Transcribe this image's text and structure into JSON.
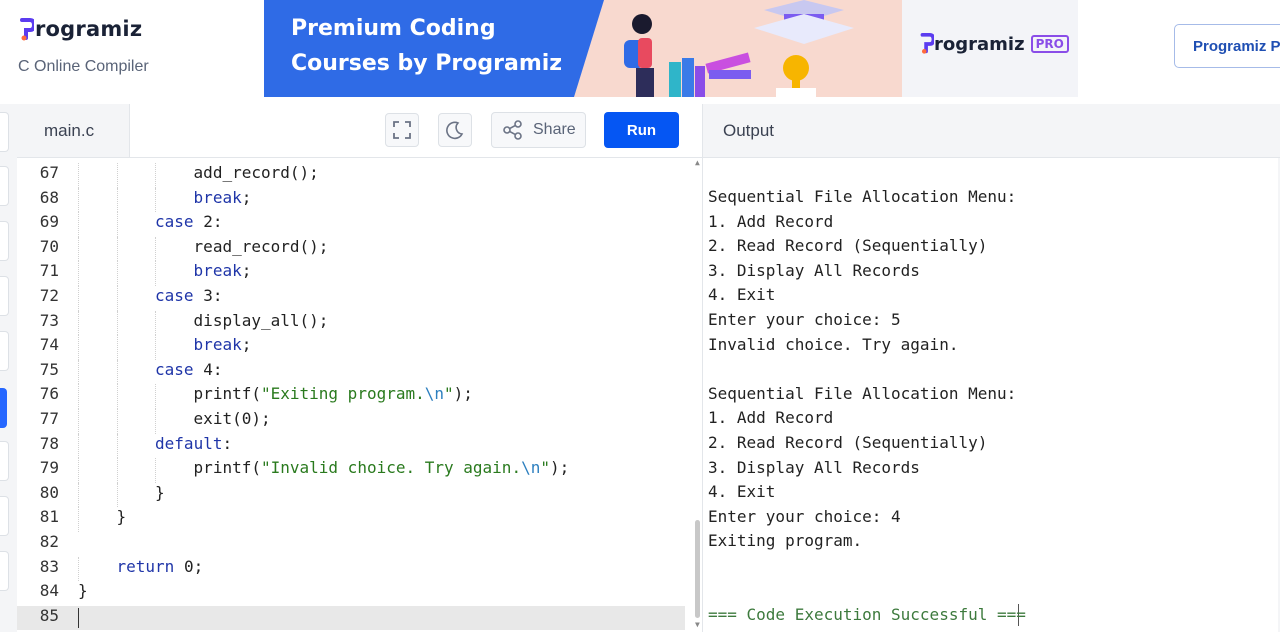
{
  "header": {
    "brand": "rogramiz",
    "subtitle": "C Online Compiler",
    "banner_line1": "Premium Coding",
    "banner_line2": "Courses by Programiz",
    "banner_brand": "rogramiz",
    "banner_badge": "PRO",
    "pro_button": "Programiz P"
  },
  "editor": {
    "file_tab": "main.c",
    "share_label": "Share",
    "run_label": "Run"
  },
  "output": {
    "title": "Output",
    "lines": [
      "",
      "Sequential File Allocation Menu:",
      "1. Add Record",
      "2. Read Record (Sequentially)",
      "3. Display All Records",
      "4. Exit",
      "Enter your choice: 5",
      "Invalid choice. Try again.",
      "",
      "Sequential File Allocation Menu:",
      "1. Add Record",
      "2. Read Record (Sequentially)",
      "3. Display All Records",
      "4. Exit",
      "Enter your choice: 4",
      "Exiting program.",
      "",
      "",
      "=== Code Execution Successful ==="
    ]
  },
  "code": [
    {
      "n": "67",
      "parts": [
        [
          "fn",
          "add_record();"
        ]
      ],
      "indent": 3
    },
    {
      "n": "68",
      "parts": [
        [
          "kw",
          "break"
        ],
        [
          "fn",
          ";"
        ]
      ],
      "indent": 3
    },
    {
      "n": "69",
      "parts": [
        [
          "kw",
          "case "
        ],
        [
          "num",
          "2"
        ],
        [
          "fn",
          ":"
        ]
      ],
      "indent": 2
    },
    {
      "n": "70",
      "parts": [
        [
          "fn",
          "read_record();"
        ]
      ],
      "indent": 3
    },
    {
      "n": "71",
      "parts": [
        [
          "kw",
          "break"
        ],
        [
          "fn",
          ";"
        ]
      ],
      "indent": 3
    },
    {
      "n": "72",
      "parts": [
        [
          "kw",
          "case "
        ],
        [
          "num",
          "3"
        ],
        [
          "fn",
          ":"
        ]
      ],
      "indent": 2
    },
    {
      "n": "73",
      "parts": [
        [
          "fn",
          "display_all();"
        ]
      ],
      "indent": 3
    },
    {
      "n": "74",
      "parts": [
        [
          "kw",
          "break"
        ],
        [
          "fn",
          ";"
        ]
      ],
      "indent": 3
    },
    {
      "n": "75",
      "parts": [
        [
          "kw",
          "case "
        ],
        [
          "num",
          "4"
        ],
        [
          "fn",
          ":"
        ]
      ],
      "indent": 2
    },
    {
      "n": "76",
      "parts": [
        [
          "fn",
          "printf("
        ],
        [
          "str",
          "\"Exiting program."
        ],
        [
          "esc",
          "\\n"
        ],
        [
          "str",
          "\""
        ],
        [
          "fn",
          ");"
        ]
      ],
      "indent": 3
    },
    {
      "n": "77",
      "parts": [
        [
          "fn",
          "exit("
        ],
        [
          "num",
          "0"
        ],
        [
          "fn",
          ");"
        ]
      ],
      "indent": 3
    },
    {
      "n": "78",
      "parts": [
        [
          "kw",
          "default"
        ],
        [
          "fn",
          ":"
        ]
      ],
      "indent": 2
    },
    {
      "n": "79",
      "parts": [
        [
          "fn",
          "printf("
        ],
        [
          "str",
          "\"Invalid choice. Try again."
        ],
        [
          "esc",
          "\\n"
        ],
        [
          "str",
          "\""
        ],
        [
          "fn",
          ");"
        ]
      ],
      "indent": 3
    },
    {
      "n": "80",
      "parts": [
        [
          "fn",
          "}"
        ]
      ],
      "indent": 2
    },
    {
      "n": "81",
      "parts": [
        [
          "fn",
          "}"
        ]
      ],
      "indent": 1
    },
    {
      "n": "82",
      "parts": [],
      "indent": 0
    },
    {
      "n": "83",
      "parts": [
        [
          "kw",
          "return "
        ],
        [
          "num",
          "0"
        ],
        [
          "fn",
          ";"
        ]
      ],
      "indent": 1
    },
    {
      "n": "84",
      "parts": [
        [
          "fn",
          "}"
        ]
      ],
      "indent": 0
    },
    {
      "n": "85",
      "parts": [],
      "indent": 0,
      "active": true
    }
  ],
  "colors": {
    "run_button": "#0556f3",
    "keyword": "#1f35a8",
    "string": "#2a7a1e",
    "escape": "#2c7fbf",
    "success": "#3d7a3d"
  },
  "icons": [
    "fullscreen-icon",
    "dark-mode-icon",
    "share-icon"
  ]
}
